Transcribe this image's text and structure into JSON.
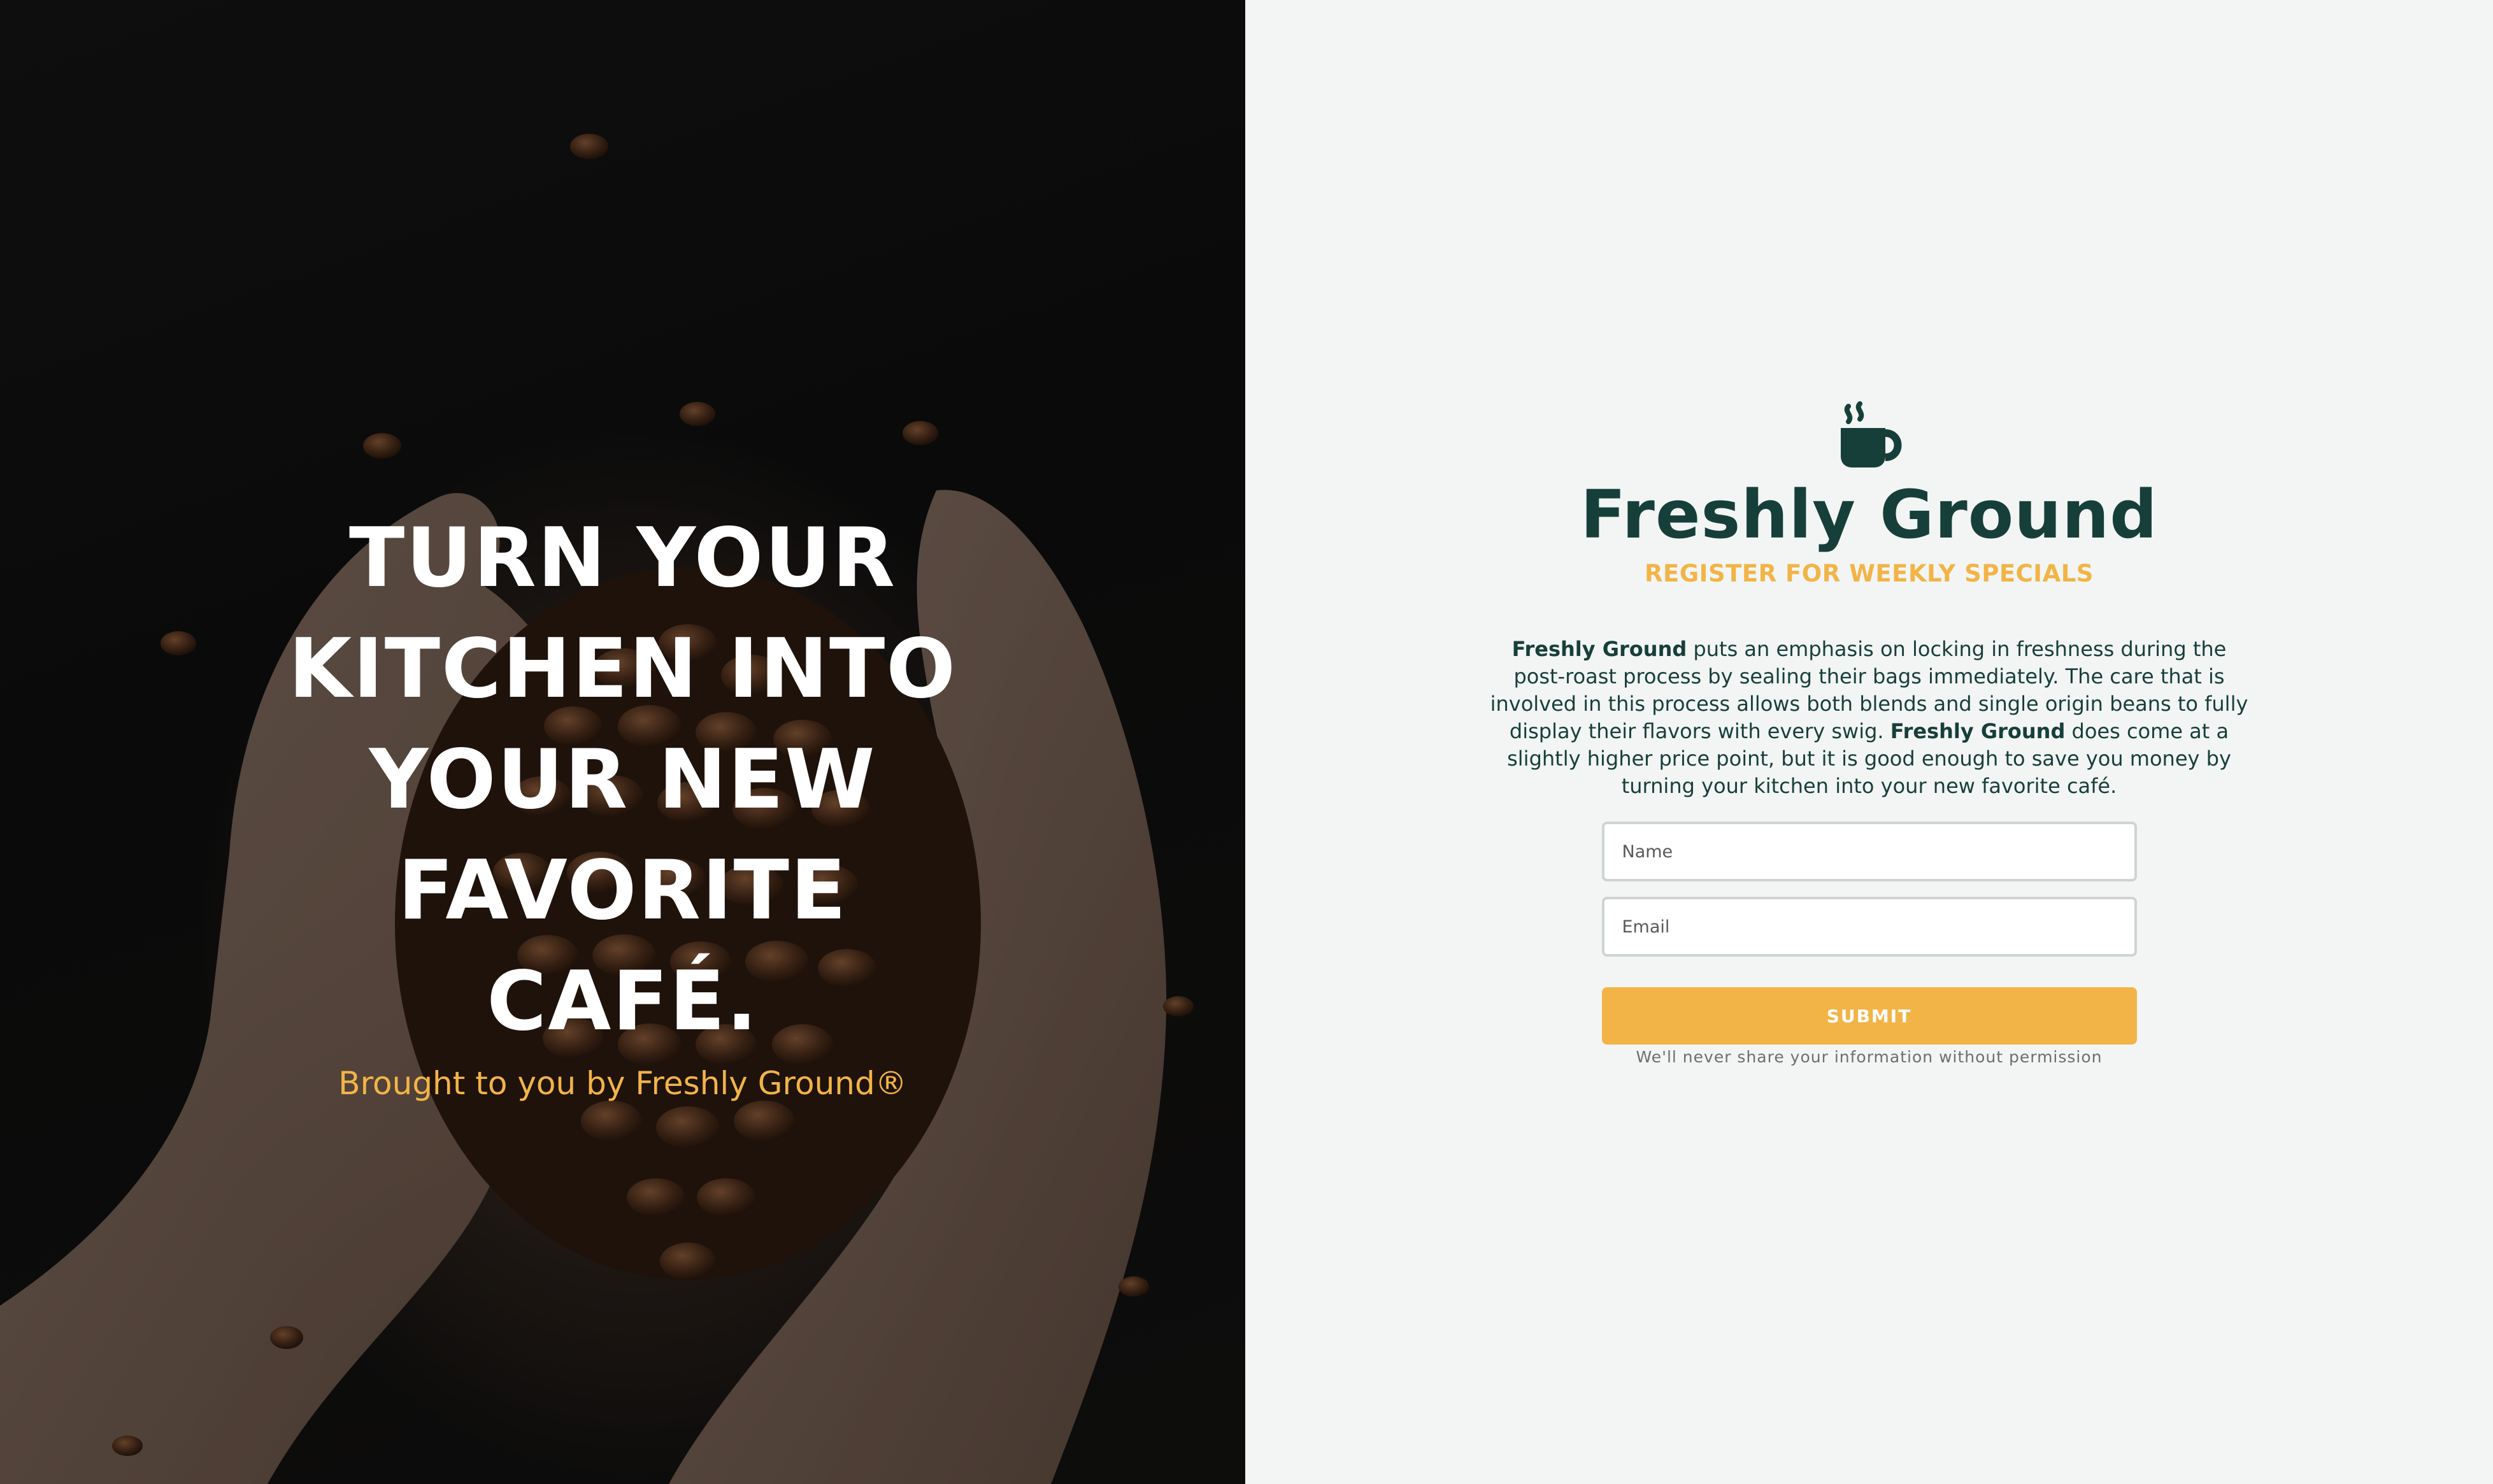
{
  "hero": {
    "title": "TURN YOUR KITCHEN INTO YOUR NEW FAVORITE CAFÉ.",
    "subtitle": "Brought to you by Freshly Ground®"
  },
  "brand": {
    "icon": "coffee-cup-icon",
    "name": "Freshly Ground",
    "tagline": "REGISTER FOR WEEKLY SPECIALS"
  },
  "description": {
    "brand_1": "Freshly Ground",
    "text_1": " puts an emphasis on locking in freshness during the post-roast process by sealing their bags immediately. The care that is involved in this process allows both blends and single origin beans to fully display their flavors with every swig. ",
    "brand_2": "Freshly Ground",
    "text_2": " does come at a slightly higher price point, but it is good enough to save you money by turning your kitchen into your new favorite café."
  },
  "form": {
    "name_placeholder": "Name",
    "email_placeholder": "Email",
    "submit_label": "SUBMIT",
    "privacy_note": "We'll never share your information without permission"
  },
  "colors": {
    "brand_green": "#173f3a",
    "accent_gold": "#f2b447",
    "panel_background": "#f2f5f4"
  }
}
